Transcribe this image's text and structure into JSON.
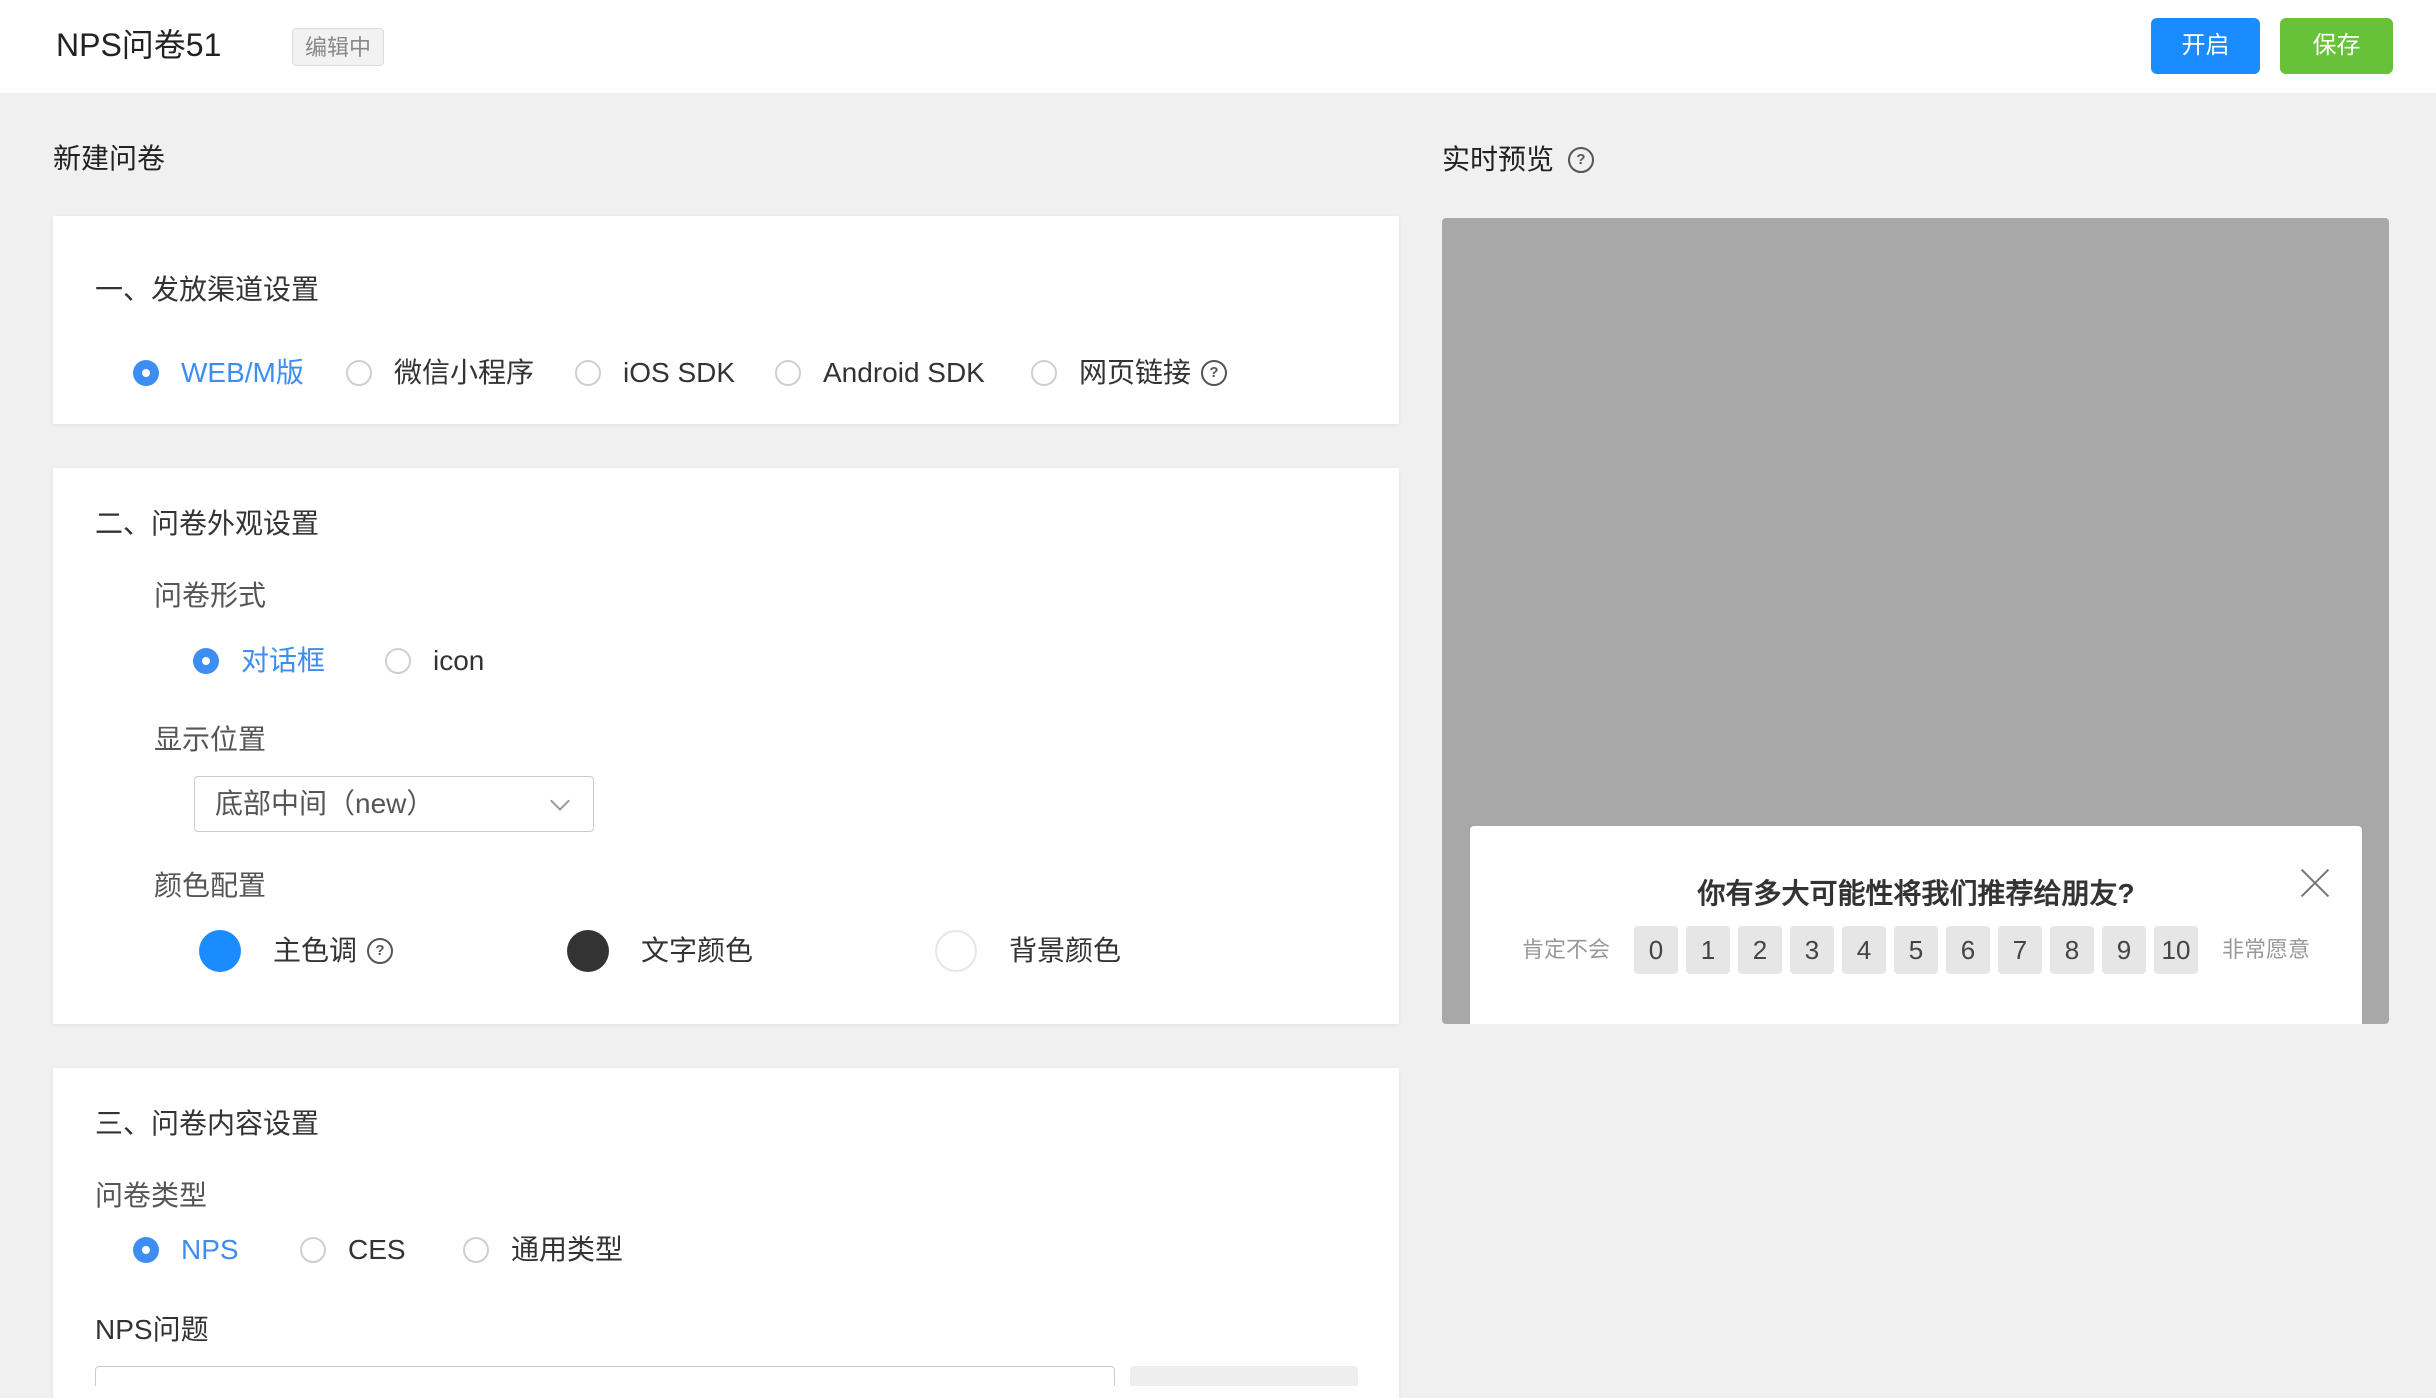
{
  "header": {
    "title": "NPS问卷51",
    "status": "编辑中",
    "start_label": "开启",
    "save_label": "保存"
  },
  "left": {
    "page_title": "新建问卷",
    "channel": {
      "title": "一、发放渠道设置",
      "options": [
        {
          "label": "WEB/M版",
          "checked": true
        },
        {
          "label": "微信小程序",
          "checked": false
        },
        {
          "label": "iOS SDK",
          "checked": false
        },
        {
          "label": "Android SDK",
          "checked": false
        },
        {
          "label": "网页链接",
          "checked": false
        }
      ]
    },
    "appearance": {
      "title": "二、问卷外观设置",
      "form_label": "问卷形式",
      "form_options": [
        {
          "label": "对话框",
          "checked": true
        },
        {
          "label": "icon",
          "checked": false
        }
      ],
      "position_label": "显示位置",
      "position_value": "底部中间（new）",
      "color_label": "颜色配置",
      "colors": [
        {
          "label": "主色调",
          "color": "#1a8cff"
        },
        {
          "label": "文字颜色",
          "color": "#333333"
        },
        {
          "label": "背景颜色",
          "color": "#ffffff"
        }
      ]
    },
    "content": {
      "title": "三、问卷内容设置",
      "type_label": "问卷类型",
      "type_options": [
        {
          "label": "NPS",
          "checked": true
        },
        {
          "label": "CES",
          "checked": false
        },
        {
          "label": "通用类型",
          "checked": false
        }
      ],
      "question_label": "NPS问题"
    }
  },
  "preview": {
    "title": "实时预览",
    "question": "你有多大可能性将我们推荐给朋友?",
    "low_label": "肯定不会",
    "high_label": "非常愿意",
    "scores": [
      "0",
      "1",
      "2",
      "3",
      "4",
      "5",
      "6",
      "7",
      "8",
      "9",
      "10"
    ]
  },
  "icons": [
    "help-icon",
    "chevron-down-icon",
    "close-icon"
  ]
}
